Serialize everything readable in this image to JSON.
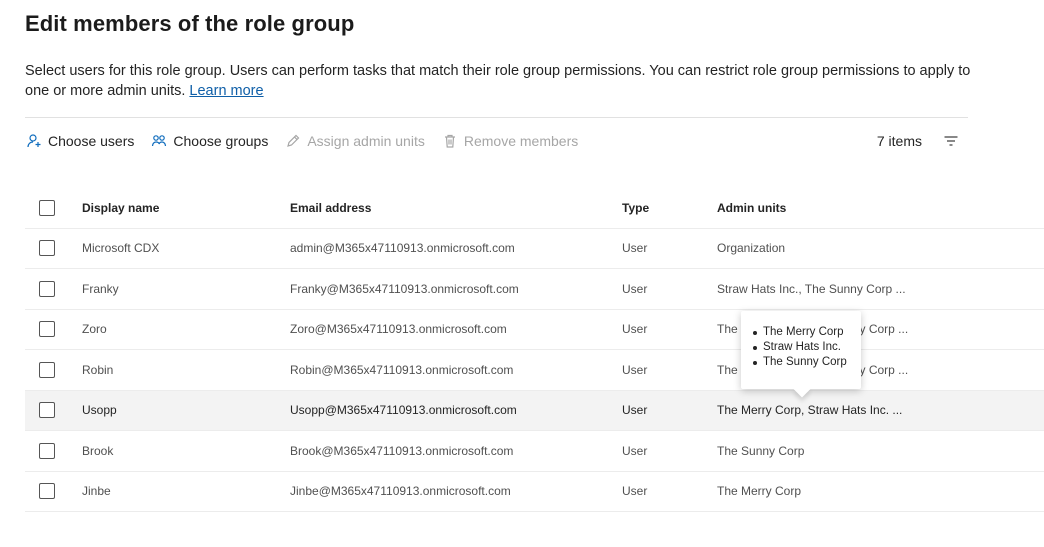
{
  "page": {
    "title": "Edit members of the role group",
    "description": "Select users for this role group. Users can perform tasks that match their role group permissions. You can restrict role group permissions to apply to one or more admin units. ",
    "learn_more": "Learn more"
  },
  "toolbar": {
    "choose_users": "Choose users",
    "choose_groups": "Choose groups",
    "assign_admin_units": "Assign admin units",
    "remove_members": "Remove members",
    "item_count": "7 items",
    "icons": {
      "choose_users": "person-add-icon",
      "choose_groups": "people-icon",
      "assign_admin_units": "pencil-icon",
      "remove_members": "trash-icon",
      "filter": "filter-icon"
    }
  },
  "table": {
    "headers": {
      "display_name": "Display name",
      "email": "Email address",
      "type": "Type",
      "admin_units": "Admin units"
    },
    "rows": [
      {
        "name": "Microsoft CDX",
        "email": "admin@M365x47110913.onmicrosoft.com",
        "type": "User",
        "admin_units": "Organization"
      },
      {
        "name": "Franky",
        "email": "Franky@M365x47110913.onmicrosoft.com",
        "type": "User",
        "admin_units": "Straw Hats Inc., The Sunny Corp ..."
      },
      {
        "name": "Zoro",
        "email": "Zoro@M365x47110913.onmicrosoft.com",
        "type": "User",
        "admin_units": "The Merry Corp, The Sunny Corp ..."
      },
      {
        "name": "Robin",
        "email": "Robin@M365x47110913.onmicrosoft.com",
        "type": "User",
        "admin_units": "The Merry Corp, The Sunny Corp ..."
      },
      {
        "name": "Usopp",
        "email": "Usopp@M365x47110913.onmicrosoft.com",
        "type": "User",
        "admin_units": "The Merry Corp, Straw Hats Inc. ..."
      },
      {
        "name": "Brook",
        "email": "Brook@M365x47110913.onmicrosoft.com",
        "type": "User",
        "admin_units": "The Sunny Corp"
      },
      {
        "name": "Jinbe",
        "email": "Jinbe@M365x47110913.onmicrosoft.com",
        "type": "User",
        "admin_units": "The Merry Corp"
      }
    ],
    "highlighted_row": "Usopp"
  },
  "tooltip": {
    "items": [
      "The Merry Corp",
      "Straw Hats Inc.",
      "The Sunny Corp"
    ]
  }
}
